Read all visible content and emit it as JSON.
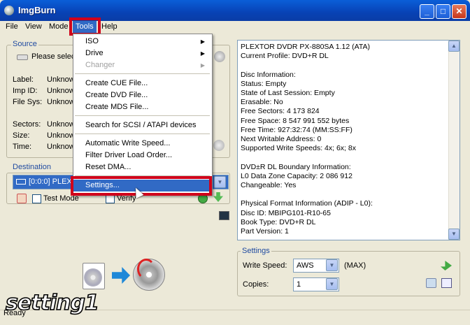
{
  "window": {
    "title": "ImgBurn"
  },
  "menubar": {
    "items": [
      "File",
      "View",
      "Mode",
      "Tools",
      "Help"
    ]
  },
  "source": {
    "group_label": "Source",
    "drive_placeholder": "Please selec",
    "fields": [
      {
        "label": "Label:",
        "value": "Unknow"
      },
      {
        "label": "Imp ID:",
        "value": "Unknow"
      },
      {
        "label": "File Sys:",
        "value": "Unknow"
      },
      {
        "label": "Sectors:",
        "value": "Unknow"
      },
      {
        "label": "Size:",
        "value": "Unknow"
      },
      {
        "label": "Time:",
        "value": "Unknow"
      }
    ]
  },
  "destination": {
    "group_label": "Destination",
    "drive_value": "[0:0:0] PLEX",
    "test_mode_label": "Test Mode",
    "verify_label": "Verify"
  },
  "tools_menu": {
    "items": [
      {
        "label": "ISO",
        "submenu": true
      },
      {
        "label": "Drive",
        "submenu": true
      },
      {
        "label": "Changer",
        "submenu": true,
        "disabled": true
      },
      {
        "label": "Create CUE File..."
      },
      {
        "label": "Create DVD File..."
      },
      {
        "label": "Create MDS File..."
      },
      {
        "label": "Search for SCSI / ATAPI devices"
      },
      {
        "label": "Automatic Write Speed..."
      },
      {
        "label": "Filter Driver Load Order..."
      },
      {
        "label": "Reset DMA..."
      },
      {
        "label": "Settings..."
      }
    ]
  },
  "info": {
    "lines": [
      "PLEXTOR DVDR   PX-880SA 1.12 (ATA)",
      "Current Profile: DVD+R DL",
      "",
      "Disc Information:",
      "Status: Empty",
      "State of Last Session: Empty",
      "Erasable: No",
      "Free Sectors: 4 173 824",
      "Free Space: 8 547 991 552 bytes",
      "Free Time: 927:32:74 (MM:SS:FF)",
      "Next Writable Address: 0",
      "Supported Write Speeds: 4x; 6x; 8x",
      "",
      "DVD±R DL Boundary Information:",
      "L0 Data Zone Capacity: 2 086 912",
      "Changeable: Yes",
      "",
      "Physical Format Information (ADIP - L0):",
      "Disc ID: MBIPG101-R10-65",
      "Book Type: DVD+R DL",
      "Part Version: 1"
    ]
  },
  "settings": {
    "group_label": "Settings",
    "write_speed_label": "Write Speed:",
    "write_speed_value": "AWS",
    "write_speed_max": "(MAX)",
    "copies_label": "Copies:",
    "copies_value": "1"
  },
  "status": {
    "text": "Ready"
  },
  "annotation": {
    "caption": "setting1"
  },
  "colors": {
    "highlight": "#316ac5",
    "annotation_box": "#d0021b"
  }
}
